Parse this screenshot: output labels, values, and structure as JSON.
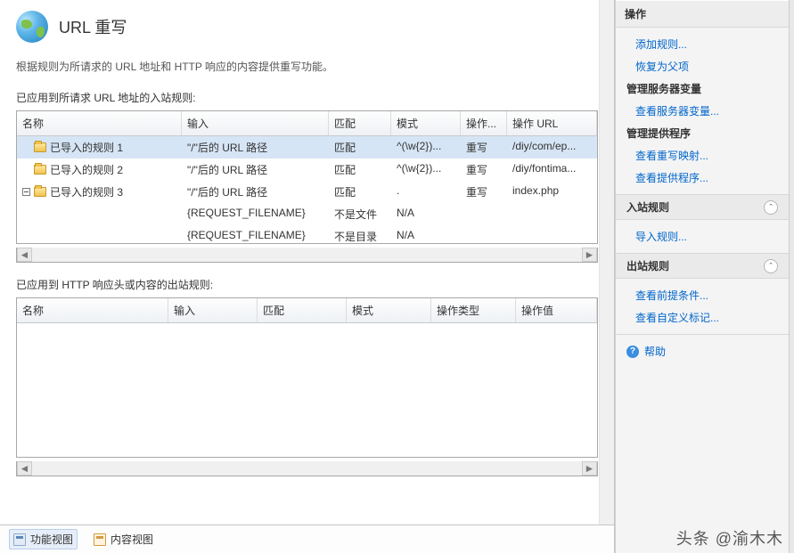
{
  "header": {
    "title": "URL 重写",
    "description": "根据规则为所请求的 URL 地址和 HTTP 响应的内容提供重写功能。"
  },
  "inbound": {
    "section_label": "已应用到所请求 URL 地址的入站规则:",
    "columns": [
      "名称",
      "输入",
      "匹配",
      "模式",
      "操作...",
      "操作 URL"
    ],
    "rows": [
      {
        "name": "已导入的规则 1",
        "input": "\"/\"后的 URL 路径",
        "match": "匹配",
        "pattern": "^(\\w{2})...",
        "action": "重写",
        "action_url": "/diy/com/ep...",
        "indent": 1
      },
      {
        "name": "已导入的规则 2",
        "input": "\"/\"后的 URL 路径",
        "match": "匹配",
        "pattern": "^(\\w{2})...",
        "action": "重写",
        "action_url": "/diy/fontima...",
        "indent": 1
      },
      {
        "name": "已导入的规则 3",
        "input": "\"/\"后的 URL 路径",
        "match": "匹配",
        "pattern": ".",
        "action": "重写",
        "action_url": "index.php",
        "indent": 0,
        "expanded": true
      },
      {
        "name": "",
        "input": "{REQUEST_FILENAME}",
        "match": "不是文件",
        "pattern": "N/A",
        "action": "",
        "action_url": "",
        "indent": "sub"
      },
      {
        "name": "",
        "input": "{REQUEST_FILENAME}",
        "match": "不是目录",
        "pattern": "N/A",
        "action": "",
        "action_url": "",
        "indent": "sub"
      }
    ]
  },
  "outbound": {
    "section_label": "已应用到 HTTP 响应头或内容的出站规则:",
    "columns": [
      "名称",
      "输入",
      "匹配",
      "模式",
      "操作类型",
      "操作值"
    ]
  },
  "view_tabs": {
    "features": "功能视图",
    "content": "内容视图"
  },
  "actions": {
    "header": "操作",
    "add_rule": "添加规则...",
    "revert_parent": "恢复为父项",
    "server_vars_title": "管理服务器变量",
    "view_server_vars": "查看服务器变量...",
    "providers_title": "管理提供程序",
    "view_rewrite_map": "查看重写映射...",
    "view_providers": "查看提供程序...",
    "inbound_title": "入站规则",
    "import_rules": "导入规则...",
    "outbound_title": "出站规则",
    "view_preconditions": "查看前提条件...",
    "view_custom_tags": "查看自定义标记...",
    "help": "帮助"
  },
  "watermark": "头条 @渝木木"
}
